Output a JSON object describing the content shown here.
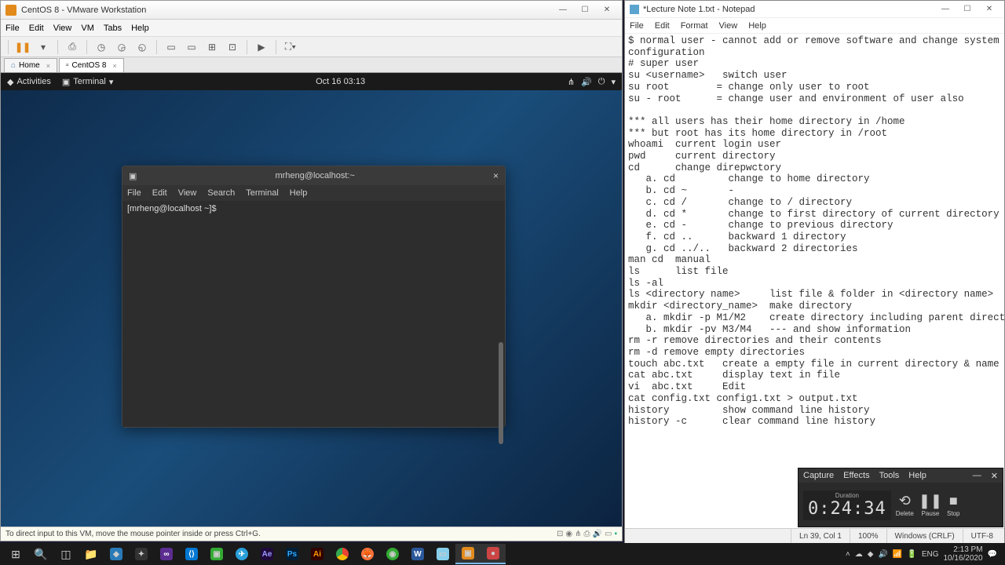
{
  "vmware": {
    "title": "CentOS 8 - VMware Workstation",
    "menu": [
      "File",
      "Edit",
      "View",
      "VM",
      "Tabs",
      "Help"
    ],
    "tabs": {
      "home": "Home",
      "vm": "CentOS 8"
    },
    "status": "To direct input to this VM, move the mouse pointer inside or press Ctrl+G."
  },
  "gnome": {
    "activities": "Activities",
    "app": "Terminal",
    "date": "Oct 16  03:13"
  },
  "terminal": {
    "title": "mrheng@localhost:~",
    "menu": [
      "File",
      "Edit",
      "View",
      "Search",
      "Terminal",
      "Help"
    ],
    "prompt": "[mrheng@localhost ~]$ "
  },
  "notepad": {
    "title": "*Lecture Note 1.txt - Notepad",
    "menu": [
      "File",
      "Edit",
      "Format",
      "View",
      "Help"
    ],
    "content": "$ normal user - cannot add or remove software and change system\nconfiguration\n# super user\nsu <username>   switch user\nsu root        = change only user to root\nsu - root      = change user and environment of user also\n\n*** all users has their home directory in /home\n*** but root has its home directory in /root\nwhoami  current login user\npwd     current directory\ncd      change direpwctory\n   a. cd         change to home directory\n   b. cd ~       -\n   c. cd /       change to / directory\n   d. cd *       change to first directory of current directory\n   e. cd -       change to previous directory\n   f. cd ..      backward 1 directory\n   g. cd ../..   backward 2 directories\nman cd  manual\nls      list file\nls -al\nls <directory name>     list file & folder in <directory name>\nmkdir <directory_name>  make directory\n   a. mkdir -p M1/M2    create directory including parent directoires\n   b. mkdir -pv M3/M4   --- and show information\nrm -r remove directories and their contents\nrm -d remove empty directories\ntouch abc.txt   create a empty file in current directory & name it q\ncat abc.txt     display text in file\nvi  abc.txt     Edit\ncat config.txt config1.txt > output.txt\nhistory         show command line history\nhistory -c      clear command line history",
    "status": {
      "pos": "Ln 39, Col 1",
      "zoom": "100%",
      "eol": "Windows (CRLF)",
      "enc": "UTF-8"
    }
  },
  "recorder": {
    "menu": [
      "Capture",
      "Effects",
      "Tools",
      "Help"
    ],
    "dur_label": "Duration",
    "time": "0:24:34",
    "btns": {
      "delete": "Delete",
      "pause": "Pause",
      "stop": "Stop"
    }
  },
  "tray": {
    "lang": "ENG",
    "time": "2:13 PM",
    "date": "10/16/2020"
  }
}
